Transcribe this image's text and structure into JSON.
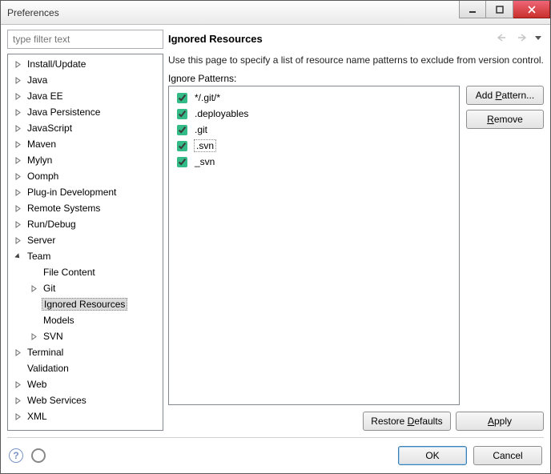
{
  "window": {
    "title": "Preferences"
  },
  "filter": {
    "placeholder": "type filter text"
  },
  "tree": [
    {
      "label": "Install/Update",
      "depth": 1,
      "expandable": true,
      "expanded": false
    },
    {
      "label": "Java",
      "depth": 1,
      "expandable": true,
      "expanded": false
    },
    {
      "label": "Java EE",
      "depth": 1,
      "expandable": true,
      "expanded": false
    },
    {
      "label": "Java Persistence",
      "depth": 1,
      "expandable": true,
      "expanded": false
    },
    {
      "label": "JavaScript",
      "depth": 1,
      "expandable": true,
      "expanded": false
    },
    {
      "label": "Maven",
      "depth": 1,
      "expandable": true,
      "expanded": false
    },
    {
      "label": "Mylyn",
      "depth": 1,
      "expandable": true,
      "expanded": false
    },
    {
      "label": "Oomph",
      "depth": 1,
      "expandable": true,
      "expanded": false
    },
    {
      "label": "Plug-in Development",
      "depth": 1,
      "expandable": true,
      "expanded": false
    },
    {
      "label": "Remote Systems",
      "depth": 1,
      "expandable": true,
      "expanded": false
    },
    {
      "label": "Run/Debug",
      "depth": 1,
      "expandable": true,
      "expanded": false
    },
    {
      "label": "Server",
      "depth": 1,
      "expandable": true,
      "expanded": false
    },
    {
      "label": "Team",
      "depth": 1,
      "expandable": true,
      "expanded": true
    },
    {
      "label": "File Content",
      "depth": 2,
      "expandable": false
    },
    {
      "label": "Git",
      "depth": 2,
      "expandable": true,
      "expanded": false
    },
    {
      "label": "Ignored Resources",
      "depth": 2,
      "expandable": false,
      "selected": true
    },
    {
      "label": "Models",
      "depth": 2,
      "expandable": false
    },
    {
      "label": "SVN",
      "depth": 2,
      "expandable": true,
      "expanded": false
    },
    {
      "label": "Terminal",
      "depth": 1,
      "expandable": true,
      "expanded": false
    },
    {
      "label": "Validation",
      "depth": 1,
      "expandable": false
    },
    {
      "label": "Web",
      "depth": 1,
      "expandable": true,
      "expanded": false
    },
    {
      "label": "Web Services",
      "depth": 1,
      "expandable": true,
      "expanded": false
    },
    {
      "label": "XML",
      "depth": 1,
      "expandable": true,
      "expanded": false
    }
  ],
  "page": {
    "title": "Ignored Resources",
    "description": "Use this page to specify a list of resource name patterns to exclude from version control.",
    "list_label": "Ignore Patterns:"
  },
  "patterns": [
    {
      "text": "*/.git/*",
      "checked": true,
      "selected": false
    },
    {
      "text": ".deployables",
      "checked": true,
      "selected": false
    },
    {
      "text": ".git",
      "checked": true,
      "selected": false
    },
    {
      "text": ".svn",
      "checked": true,
      "selected": true
    },
    {
      "text": "_svn",
      "checked": true,
      "selected": false
    }
  ],
  "buttons": {
    "add_pattern": "Add Pattern...",
    "remove": "Remove",
    "restore_defaults": "Restore Defaults",
    "apply": "Apply",
    "ok": "OK",
    "cancel": "Cancel"
  }
}
